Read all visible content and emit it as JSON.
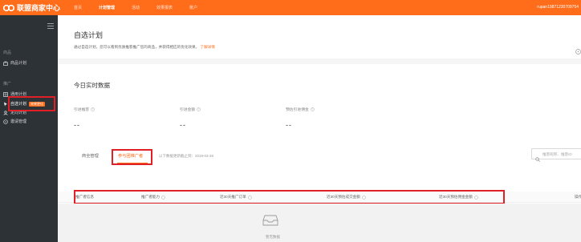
{
  "header": {
    "logo_text": "联盟商家中心",
    "nav": [
      "首页",
      "计划管理",
      "活动",
      "效果报表",
      "账户"
    ],
    "active_nav_index": 1,
    "account": "rupan19871230709754"
  },
  "sidebar": {
    "group1_label": "商品",
    "item_product_plan": "商品计划",
    "group2_label": "推广",
    "item_general_plan": "通用计划",
    "item_selected_plan": "自选计划",
    "item_selected_badge": "效果更佳",
    "item_targeted_plan": "定向计划",
    "item_invite_mgmt": "邀请管理"
  },
  "page": {
    "title": "自选计划",
    "description": "通过自选计划，您可以看到优质推客推广您的商品，并获得相应的优化效果。",
    "description_link": "了解详情"
  },
  "realtime": {
    "title": "今日实时数据",
    "stats": [
      {
        "label": "引进推客",
        "value": "--"
      },
      {
        "label": "引进金额",
        "value": "--"
      },
      {
        "label": "预估引进佣金",
        "value": "--"
      }
    ]
  },
  "tabs": {
    "items": [
      "商全管理",
      "参与团推广者"
    ],
    "active_index": 1,
    "note": "以下数据更新截止到：2019-03-26"
  },
  "search": {
    "placeholder": "推客昵称、推客ID"
  },
  "table": {
    "columns": [
      "推广者信息",
      "推广者能力",
      "近30天推广订单",
      "近30天预估成交金额",
      "近30天预估佣金金额",
      "操作"
    ]
  },
  "empty_state": {
    "text": "暂无数据"
  },
  "colors": {
    "brand": "#ff6c1a",
    "sidebar_bg": "#2d3237",
    "highlight_box": "#e01f26"
  }
}
